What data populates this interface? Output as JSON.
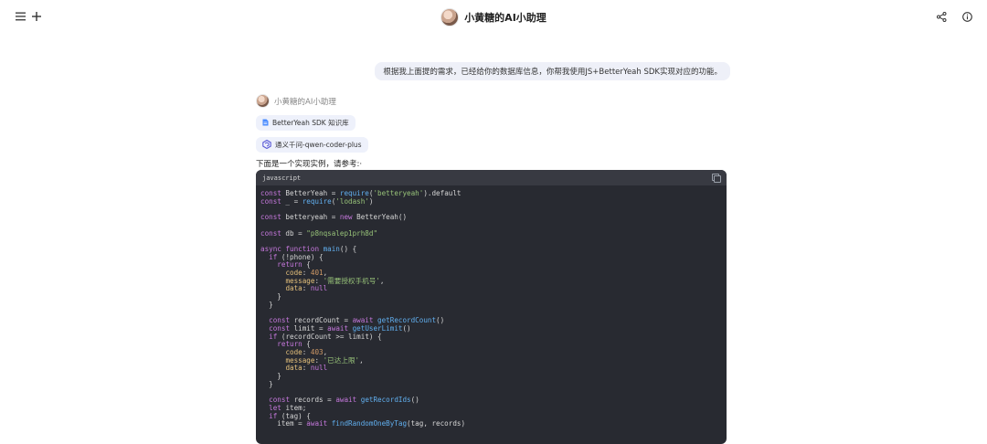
{
  "app": {
    "title": "小黄糖的AI小助理"
  },
  "header": {
    "menu_icon": "menu-icon",
    "new_icon": "plus-icon",
    "share_icon": "share-icon",
    "info_icon": "info-icon"
  },
  "conversation": {
    "user_message": "根据我上面提的需求，已经给你的数据库信息，你帮我使用JS+BetterYeah SDK实现对应的功能。",
    "bot_name": "小黄糖的AI小助理",
    "chips": [
      {
        "label": "BetterYeah SDK 知识库",
        "icon": "document-icon"
      },
      {
        "label": "通义千问-qwen-coder-plus",
        "icon": "model-icon"
      }
    ],
    "intro": "下面是一个实现实例，请参考:·",
    "code": {
      "language": "javascript",
      "lines": [
        "const BetterYeah = require('betteryeah').default",
        "const _ = require('lodash')",
        "",
        "const betteryeah = new BetterYeah()",
        "",
        "const db = \"p8nqsalep1prh8d\"",
        "",
        "async function main() {",
        "  if (!phone) {",
        "    return {",
        "      code: 401,",
        "      message: '需要授权手机号',",
        "      data: null",
        "    }",
        "  }",
        "",
        "  const recordCount = await getRecordCount()",
        "  const limit = await getUserLimit()",
        "  if (recordCount >= limit) {",
        "    return {",
        "      code: 403,",
        "      message: '已达上限',",
        "      data: null",
        "    }",
        "  }",
        "",
        "  const records = await getRecordIds()",
        "  let item;",
        "  if (tag) {",
        "    item = await findRandomOneByTag(tag, records)"
      ]
    }
  }
}
